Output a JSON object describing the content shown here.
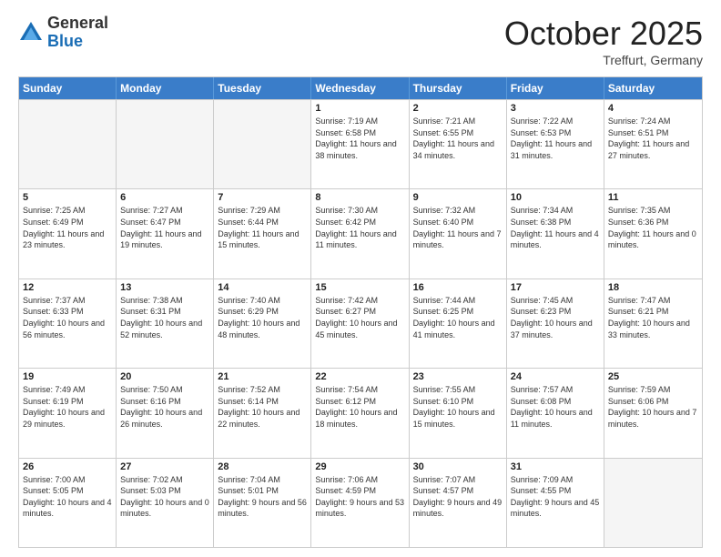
{
  "logo": {
    "general": "General",
    "blue": "Blue"
  },
  "title": "October 2025",
  "location": "Treffurt, Germany",
  "headers": [
    "Sunday",
    "Monday",
    "Tuesday",
    "Wednesday",
    "Thursday",
    "Friday",
    "Saturday"
  ],
  "rows": [
    [
      {
        "day": "",
        "info": ""
      },
      {
        "day": "",
        "info": ""
      },
      {
        "day": "",
        "info": ""
      },
      {
        "day": "1",
        "info": "Sunrise: 7:19 AM\nSunset: 6:58 PM\nDaylight: 11 hours and 38 minutes."
      },
      {
        "day": "2",
        "info": "Sunrise: 7:21 AM\nSunset: 6:55 PM\nDaylight: 11 hours and 34 minutes."
      },
      {
        "day": "3",
        "info": "Sunrise: 7:22 AM\nSunset: 6:53 PM\nDaylight: 11 hours and 31 minutes."
      },
      {
        "day": "4",
        "info": "Sunrise: 7:24 AM\nSunset: 6:51 PM\nDaylight: 11 hours and 27 minutes."
      }
    ],
    [
      {
        "day": "5",
        "info": "Sunrise: 7:25 AM\nSunset: 6:49 PM\nDaylight: 11 hours and 23 minutes."
      },
      {
        "day": "6",
        "info": "Sunrise: 7:27 AM\nSunset: 6:47 PM\nDaylight: 11 hours and 19 minutes."
      },
      {
        "day": "7",
        "info": "Sunrise: 7:29 AM\nSunset: 6:44 PM\nDaylight: 11 hours and 15 minutes."
      },
      {
        "day": "8",
        "info": "Sunrise: 7:30 AM\nSunset: 6:42 PM\nDaylight: 11 hours and 11 minutes."
      },
      {
        "day": "9",
        "info": "Sunrise: 7:32 AM\nSunset: 6:40 PM\nDaylight: 11 hours and 7 minutes."
      },
      {
        "day": "10",
        "info": "Sunrise: 7:34 AM\nSunset: 6:38 PM\nDaylight: 11 hours and 4 minutes."
      },
      {
        "day": "11",
        "info": "Sunrise: 7:35 AM\nSunset: 6:36 PM\nDaylight: 11 hours and 0 minutes."
      }
    ],
    [
      {
        "day": "12",
        "info": "Sunrise: 7:37 AM\nSunset: 6:33 PM\nDaylight: 10 hours and 56 minutes."
      },
      {
        "day": "13",
        "info": "Sunrise: 7:38 AM\nSunset: 6:31 PM\nDaylight: 10 hours and 52 minutes."
      },
      {
        "day": "14",
        "info": "Sunrise: 7:40 AM\nSunset: 6:29 PM\nDaylight: 10 hours and 48 minutes."
      },
      {
        "day": "15",
        "info": "Sunrise: 7:42 AM\nSunset: 6:27 PM\nDaylight: 10 hours and 45 minutes."
      },
      {
        "day": "16",
        "info": "Sunrise: 7:44 AM\nSunset: 6:25 PM\nDaylight: 10 hours and 41 minutes."
      },
      {
        "day": "17",
        "info": "Sunrise: 7:45 AM\nSunset: 6:23 PM\nDaylight: 10 hours and 37 minutes."
      },
      {
        "day": "18",
        "info": "Sunrise: 7:47 AM\nSunset: 6:21 PM\nDaylight: 10 hours and 33 minutes."
      }
    ],
    [
      {
        "day": "19",
        "info": "Sunrise: 7:49 AM\nSunset: 6:19 PM\nDaylight: 10 hours and 29 minutes."
      },
      {
        "day": "20",
        "info": "Sunrise: 7:50 AM\nSunset: 6:16 PM\nDaylight: 10 hours and 26 minutes."
      },
      {
        "day": "21",
        "info": "Sunrise: 7:52 AM\nSunset: 6:14 PM\nDaylight: 10 hours and 22 minutes."
      },
      {
        "day": "22",
        "info": "Sunrise: 7:54 AM\nSunset: 6:12 PM\nDaylight: 10 hours and 18 minutes."
      },
      {
        "day": "23",
        "info": "Sunrise: 7:55 AM\nSunset: 6:10 PM\nDaylight: 10 hours and 15 minutes."
      },
      {
        "day": "24",
        "info": "Sunrise: 7:57 AM\nSunset: 6:08 PM\nDaylight: 10 hours and 11 minutes."
      },
      {
        "day": "25",
        "info": "Sunrise: 7:59 AM\nSunset: 6:06 PM\nDaylight: 10 hours and 7 minutes."
      }
    ],
    [
      {
        "day": "26",
        "info": "Sunrise: 7:00 AM\nSunset: 5:05 PM\nDaylight: 10 hours and 4 minutes."
      },
      {
        "day": "27",
        "info": "Sunrise: 7:02 AM\nSunset: 5:03 PM\nDaylight: 10 hours and 0 minutes."
      },
      {
        "day": "28",
        "info": "Sunrise: 7:04 AM\nSunset: 5:01 PM\nDaylight: 9 hours and 56 minutes."
      },
      {
        "day": "29",
        "info": "Sunrise: 7:06 AM\nSunset: 4:59 PM\nDaylight: 9 hours and 53 minutes."
      },
      {
        "day": "30",
        "info": "Sunrise: 7:07 AM\nSunset: 4:57 PM\nDaylight: 9 hours and 49 minutes."
      },
      {
        "day": "31",
        "info": "Sunrise: 7:09 AM\nSunset: 4:55 PM\nDaylight: 9 hours and 45 minutes."
      },
      {
        "day": "",
        "info": ""
      }
    ]
  ]
}
